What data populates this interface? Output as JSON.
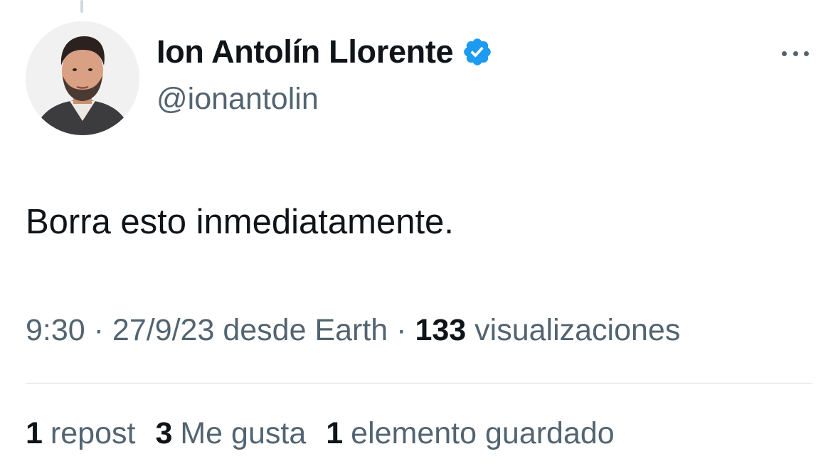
{
  "author": {
    "display_name": "Ion Antolín Llorente",
    "handle": "@ionantolin",
    "verified_color": "#1d9bf0"
  },
  "tweet": {
    "text": "Borra esto inmediatamente."
  },
  "meta": {
    "time": "9:30",
    "separator": " · ",
    "date": "27/9/23",
    "source": " desde Earth",
    "views_count": "133",
    "views_label": " visualizaciones"
  },
  "stats": {
    "reposts_count": "1",
    "reposts_label": "repost",
    "likes_count": "3",
    "likes_label": "Me gusta",
    "bookmarks_count": "1",
    "bookmarks_label": "elemento guardado"
  },
  "icons": {
    "more": "more-horizontal-icon",
    "verified": "verified-badge-icon"
  },
  "colors": {
    "text_primary": "#0f1419",
    "text_secondary": "#536471",
    "accent": "#1d9bf0"
  }
}
